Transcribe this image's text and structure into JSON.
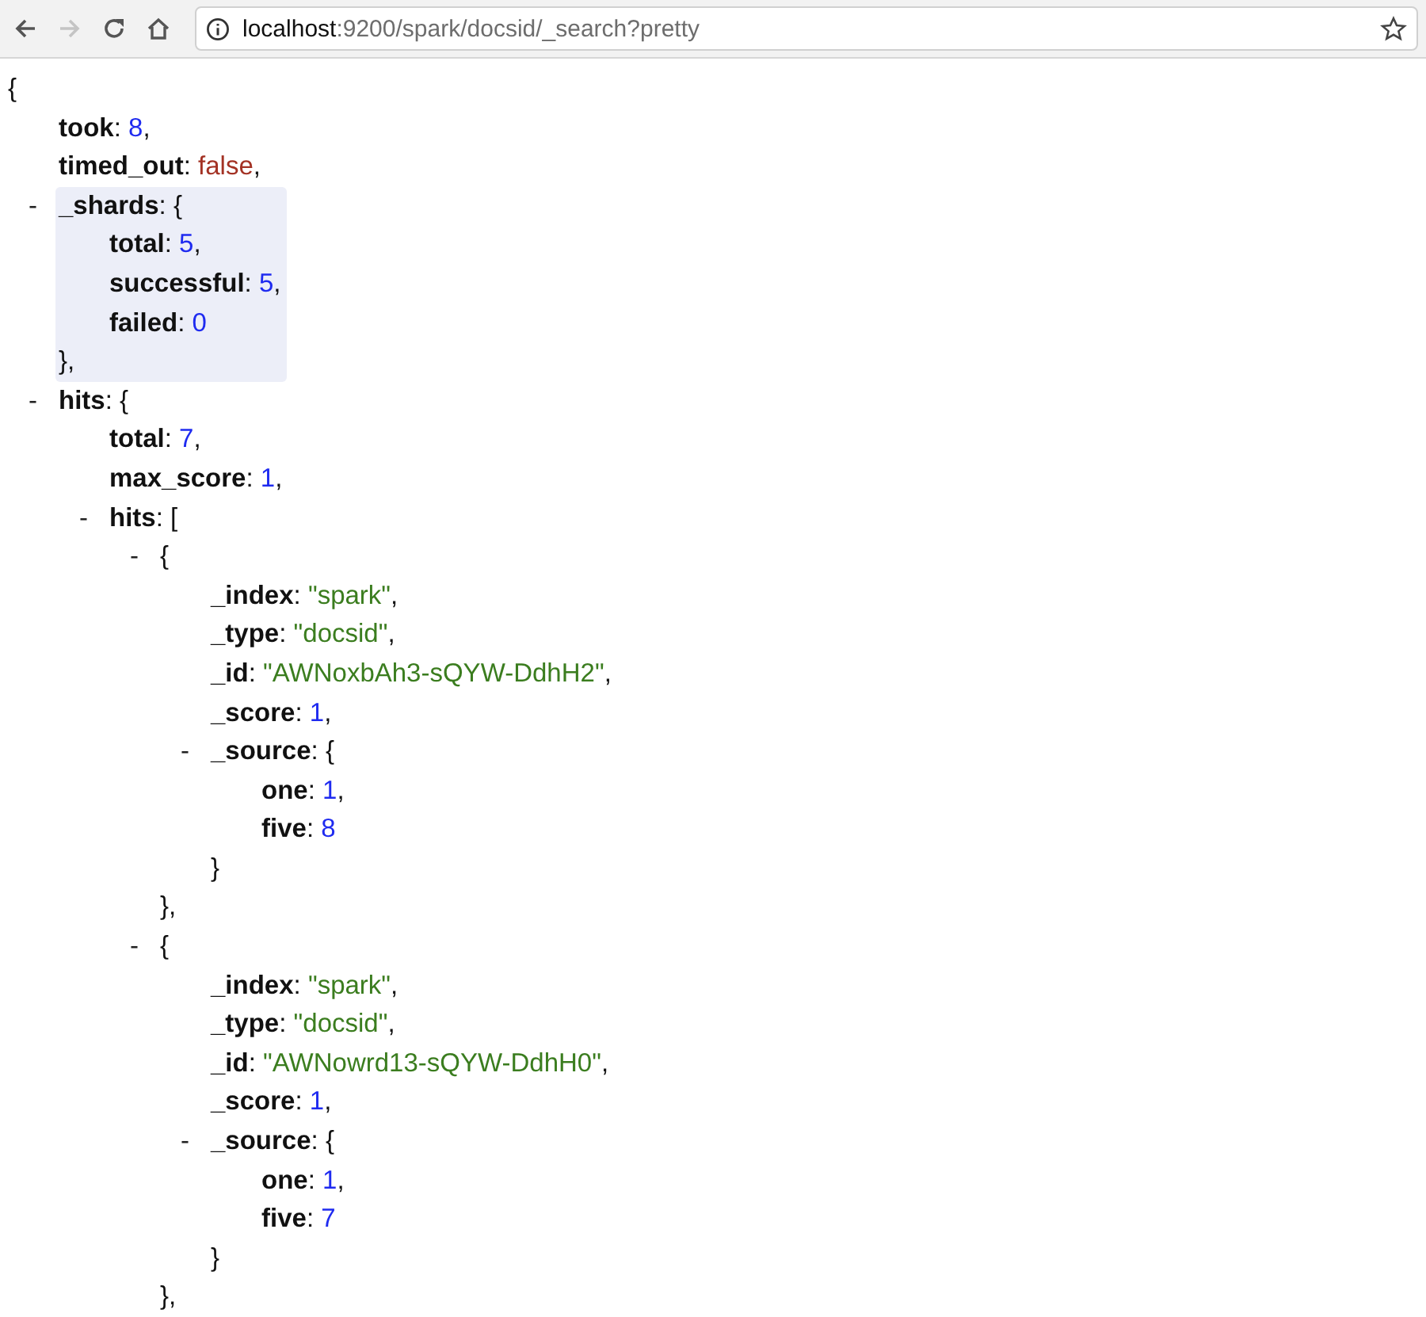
{
  "toolbar": {
    "forward_enabled": false,
    "url": {
      "host": "localhost",
      "rest": ":9200/spark/docsid/_search?pretty"
    },
    "bookmarked": false
  },
  "document": {
    "open": "{",
    "highlighted": false,
    "children": [
      {
        "key": "took",
        "sep": ":",
        "value": "8",
        "kind": "number",
        "end": ","
      },
      {
        "key": "timed_out",
        "sep": ":",
        "value": "false",
        "kind": "boolean",
        "end": ","
      },
      {
        "toggle": "-",
        "key": "_shards",
        "sep": ":",
        "open": "{",
        "highlighted": true,
        "close": "},",
        "children": [
          {
            "key": "total",
            "sep": ":",
            "value": "5",
            "kind": "number",
            "end": ","
          },
          {
            "key": "successful",
            "sep": ":",
            "value": "5",
            "kind": "number",
            "end": ","
          },
          {
            "key": "failed",
            "sep": ":",
            "value": "0",
            "kind": "number"
          }
        ]
      },
      {
        "toggle": "-",
        "key": "hits",
        "sep": ":",
        "open": "{",
        "highlighted": false,
        "children": [
          {
            "key": "total",
            "sep": ":",
            "value": "7",
            "kind": "number",
            "end": ","
          },
          {
            "key": "max_score",
            "sep": ":",
            "value": "1",
            "kind": "number",
            "end": ","
          },
          {
            "toggle": "-",
            "key": "hits",
            "sep": ":",
            "open": "[",
            "highlighted": false,
            "children": [
              {
                "toggle": "-",
                "open": "{",
                "highlighted": false,
                "close": "},",
                "children": [
                  {
                    "key": "_index",
                    "sep": ":",
                    "value": "\"spark\"",
                    "kind": "string",
                    "end": ","
                  },
                  {
                    "key": "_type",
                    "sep": ":",
                    "value": "\"docsid\"",
                    "kind": "string",
                    "end": ","
                  },
                  {
                    "key": "_id",
                    "sep": ":",
                    "value": "\"AWNoxbAh3-sQYW-DdhH2\"",
                    "kind": "string",
                    "end": ","
                  },
                  {
                    "key": "_score",
                    "sep": ":",
                    "value": "1",
                    "kind": "number",
                    "end": ","
                  },
                  {
                    "toggle": "-",
                    "key": "_source",
                    "sep": ":",
                    "open": "{",
                    "highlighted": false,
                    "close": "}",
                    "children": [
                      {
                        "key": "one",
                        "sep": ":",
                        "value": "1",
                        "kind": "number",
                        "end": ","
                      },
                      {
                        "key": "five",
                        "sep": ":",
                        "value": "8",
                        "kind": "number"
                      }
                    ]
                  }
                ]
              },
              {
                "toggle": "-",
                "open": "{",
                "highlighted": false,
                "close": "},",
                "children": [
                  {
                    "key": "_index",
                    "sep": ":",
                    "value": "\"spark\"",
                    "kind": "string",
                    "end": ","
                  },
                  {
                    "key": "_type",
                    "sep": ":",
                    "value": "\"docsid\"",
                    "kind": "string",
                    "end": ","
                  },
                  {
                    "key": "_id",
                    "sep": ":",
                    "value": "\"AWNowrd13-sQYW-DdhH0\"",
                    "kind": "string",
                    "end": ","
                  },
                  {
                    "key": "_score",
                    "sep": ":",
                    "value": "1",
                    "kind": "number",
                    "end": ","
                  },
                  {
                    "toggle": "-",
                    "key": "_source",
                    "sep": ":",
                    "open": "{",
                    "highlighted": false,
                    "close": "}",
                    "children": [
                      {
                        "key": "one",
                        "sep": ":",
                        "value": "1",
                        "kind": "number",
                        "end": ","
                      },
                      {
                        "key": "five",
                        "sep": ":",
                        "value": "7",
                        "kind": "number"
                      }
                    ]
                  }
                ]
              }
            ]
          }
        ]
      }
    ]
  }
}
